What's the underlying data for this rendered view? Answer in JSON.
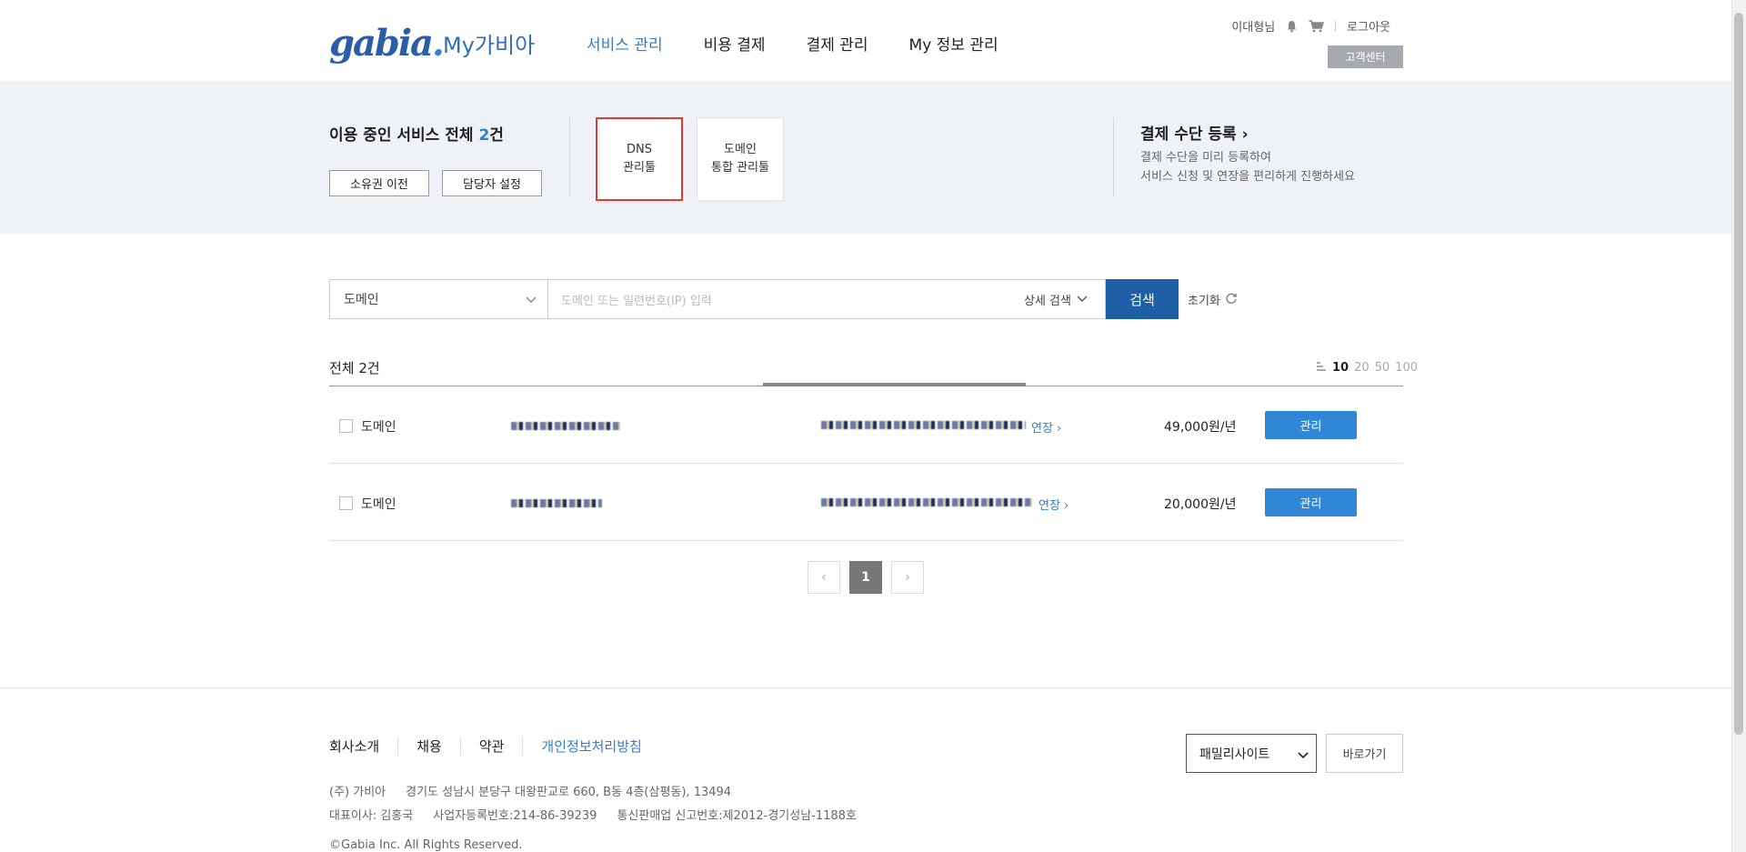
{
  "header": {
    "logo": "gabia",
    "logo_dot": ".",
    "my_title": "My가비아",
    "nav": [
      {
        "label": "서비스 관리"
      },
      {
        "label": "비용 결제"
      },
      {
        "label": "결제 관리"
      },
      {
        "label": "My 정보 관리"
      }
    ],
    "user_name": "이대형님",
    "logout": "로그아웃",
    "customer_center": "고객센터"
  },
  "summary": {
    "title_prefix": "이용 중인 서비스 전체 ",
    "count": "2",
    "title_suffix": "건",
    "transfer_button": "소유권 이전",
    "manager_button": "담당자 설정",
    "tools": [
      {
        "line1": "DNS",
        "line2": "관리툴"
      },
      {
        "line1": "도메인",
        "line2": "통합 관리툴"
      }
    ],
    "payment_title": "결제 수단 등록",
    "payment_desc1": "결제 수단을 미리 등록하여",
    "payment_desc2": "서비스 신청 및 연장을 편리하게 진행하세요"
  },
  "search": {
    "category_selected": "도메인",
    "placeholder": "도메인 또는 일련번호(IP) 입력",
    "detail_search": "상세 검색",
    "search_button": "검색",
    "reset": "초기화"
  },
  "list": {
    "total": "전체 2건",
    "page_sizes": [
      "10",
      "20",
      "50",
      "100"
    ],
    "rows": [
      {
        "type": "도메인",
        "renew": "연장 ›",
        "price": "49,000원/년",
        "manage": "관리"
      },
      {
        "type": "도메인",
        "renew": "연장 ›",
        "price": "20,000원/년",
        "manage": "관리"
      }
    ]
  },
  "pagination": {
    "prev": "‹",
    "current": "1",
    "next": "›"
  },
  "footer": {
    "links": [
      "회사소개",
      "채용",
      "약관",
      "개인정보처리방침"
    ],
    "company": "(주) 가비아",
    "address": "경기도 성남시 분당구 대왕판교로 660, B동 4층(삼평동), 13494",
    "ceo": "대표이사: 김홍국",
    "biz_no": "사업자등록번호:214-86-39239",
    "sales_no": "통신판매업 신고번호:제2012-경기성남-1188호",
    "copyright": "©Gabia Inc. All Rights Reserved.",
    "family_site": "패밀리사이트",
    "goto": "바로가기"
  },
  "colors": {
    "brand_blue": "#2f7ecb",
    "search_button": "#1f5fa6",
    "manage_button": "#2f87d6",
    "band_bg": "#eef1f5",
    "selected_border": "#e53935"
  }
}
